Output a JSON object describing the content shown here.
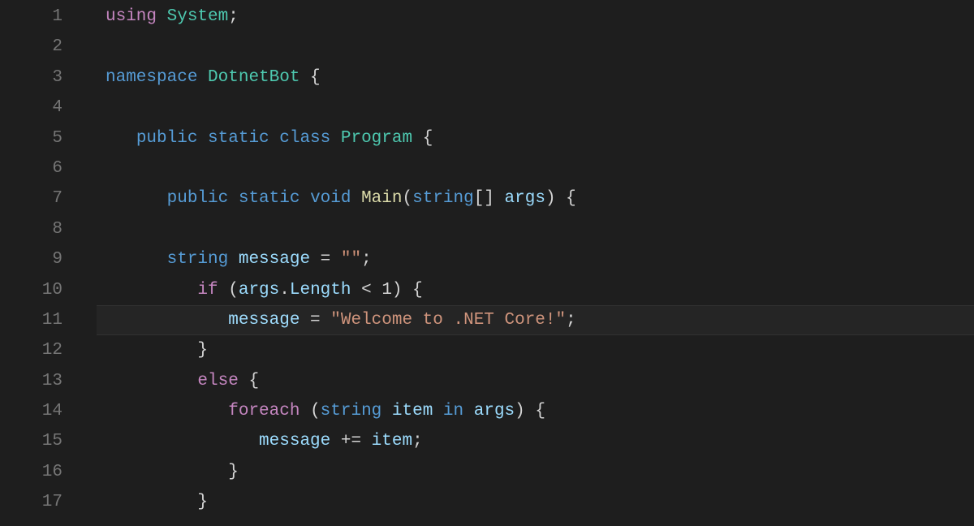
{
  "editor": {
    "highlighted_line": 11,
    "lines": [
      {
        "n": 1,
        "indent": 0,
        "tokens": [
          {
            "t": "using ",
            "c": "tk-keyword"
          },
          {
            "t": "System",
            "c": "tk-type"
          },
          {
            "t": ";",
            "c": "tk-punc"
          }
        ]
      },
      {
        "n": 2,
        "indent": 0,
        "tokens": []
      },
      {
        "n": 3,
        "indent": 0,
        "tokens": [
          {
            "t": "namespace ",
            "c": "tk-keyword2"
          },
          {
            "t": "DotnetBot",
            "c": "tk-type"
          },
          {
            "t": " {",
            "c": "tk-punc"
          }
        ]
      },
      {
        "n": 4,
        "indent": 0,
        "tokens": []
      },
      {
        "n": 5,
        "indent": 1,
        "tokens": [
          {
            "t": "public ",
            "c": "tk-keyword2"
          },
          {
            "t": "static ",
            "c": "tk-keyword2"
          },
          {
            "t": "class ",
            "c": "tk-keyword2"
          },
          {
            "t": "Program",
            "c": "tk-type"
          },
          {
            "t": " {",
            "c": "tk-punc"
          }
        ]
      },
      {
        "n": 6,
        "indent": 0,
        "tokens": []
      },
      {
        "n": 7,
        "indent": 2,
        "tokens": [
          {
            "t": "public ",
            "c": "tk-keyword2"
          },
          {
            "t": "static ",
            "c": "tk-keyword2"
          },
          {
            "t": "void ",
            "c": "tk-keyword2"
          },
          {
            "t": "Main",
            "c": "tk-method"
          },
          {
            "t": "(",
            "c": "tk-punc"
          },
          {
            "t": "string",
            "c": "tk-keyword2"
          },
          {
            "t": "[] ",
            "c": "tk-punc"
          },
          {
            "t": "args",
            "c": "tk-var"
          },
          {
            "t": ") {",
            "c": "tk-punc"
          }
        ]
      },
      {
        "n": 8,
        "indent": 0,
        "tokens": []
      },
      {
        "n": 9,
        "indent": 2,
        "tokens": [
          {
            "t": "string ",
            "c": "tk-keyword2"
          },
          {
            "t": "message",
            "c": "tk-var"
          },
          {
            "t": " = ",
            "c": "tk-op"
          },
          {
            "t": "\"\"",
            "c": "tk-string"
          },
          {
            "t": ";",
            "c": "tk-punc"
          }
        ]
      },
      {
        "n": 10,
        "indent": 3,
        "tokens": [
          {
            "t": "if ",
            "c": "tk-keyword"
          },
          {
            "t": "(",
            "c": "tk-punc"
          },
          {
            "t": "args",
            "c": "tk-var"
          },
          {
            "t": ".",
            "c": "tk-punc"
          },
          {
            "t": "Length",
            "c": "tk-var"
          },
          {
            "t": " < ",
            "c": "tk-op"
          },
          {
            "t": "1",
            "c": "tk-punc"
          },
          {
            "t": ") {",
            "c": "tk-punc"
          }
        ]
      },
      {
        "n": 11,
        "indent": 4,
        "tokens": [
          {
            "t": "message",
            "c": "tk-var"
          },
          {
            "t": " = ",
            "c": "tk-op"
          },
          {
            "t": "\"Welcome to .NET Core!\"",
            "c": "tk-string"
          },
          {
            "t": ";",
            "c": "tk-punc"
          }
        ]
      },
      {
        "n": 12,
        "indent": 3,
        "tokens": [
          {
            "t": "}",
            "c": "tk-punc"
          }
        ]
      },
      {
        "n": 13,
        "indent": 3,
        "tokens": [
          {
            "t": "else ",
            "c": "tk-keyword"
          },
          {
            "t": "{",
            "c": "tk-punc"
          }
        ]
      },
      {
        "n": 14,
        "indent": 4,
        "tokens": [
          {
            "t": "foreach ",
            "c": "tk-keyword"
          },
          {
            "t": "(",
            "c": "tk-punc"
          },
          {
            "t": "string ",
            "c": "tk-keyword2"
          },
          {
            "t": "item",
            "c": "tk-var"
          },
          {
            "t": " in ",
            "c": "tk-keyword2"
          },
          {
            "t": "args",
            "c": "tk-var"
          },
          {
            "t": ") {",
            "c": "tk-punc"
          }
        ]
      },
      {
        "n": 15,
        "indent": 5,
        "tokens": [
          {
            "t": "message",
            "c": "tk-var"
          },
          {
            "t": " += ",
            "c": "tk-op"
          },
          {
            "t": "item",
            "c": "tk-var"
          },
          {
            "t": ";",
            "c": "tk-punc"
          }
        ]
      },
      {
        "n": 16,
        "indent": 4,
        "tokens": [
          {
            "t": "}",
            "c": "tk-punc"
          }
        ]
      },
      {
        "n": 17,
        "indent": 3,
        "tokens": [
          {
            "t": "}",
            "c": "tk-punc"
          }
        ]
      }
    ]
  }
}
